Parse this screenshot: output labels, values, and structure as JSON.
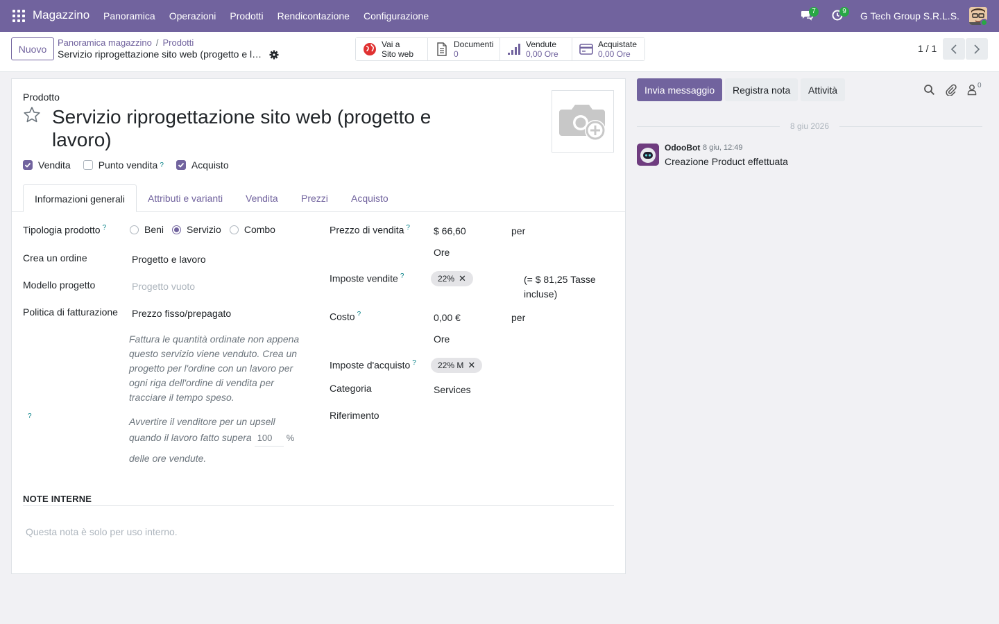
{
  "navbar": {
    "app_name": "Magazzino",
    "menu": [
      "Panoramica",
      "Operazioni",
      "Prodotti",
      "Rendicontazione",
      "Configurazione"
    ],
    "messages_badge": "7",
    "activities_badge": "9",
    "company": "G Tech Group S.R.L.S.",
    "brand_color": "#71639e"
  },
  "control": {
    "new_button": "Nuovo",
    "breadcrumb": [
      "Panoramica magazzino",
      "Prodotti"
    ],
    "breadcrumb_sep": "/",
    "record_title": "Servizio riprogettazione sito web (progetto e lavoro)",
    "smart_buttons": [
      {
        "line1": "Vai a",
        "line2": "Sito web",
        "icon": "globe-icon"
      },
      {
        "line1": "Documenti",
        "line2": "0",
        "icon": "document-icon"
      },
      {
        "line1": "Vendute",
        "line2": "0,00 Ore",
        "icon": "chart-bars-icon"
      },
      {
        "line1": "Acquistate",
        "line2": "0,00 Ore",
        "icon": "credit-card-icon"
      }
    ],
    "pager": "1 / 1"
  },
  "form": {
    "section_label": "Prodotto",
    "name": "Servizio riprogettazione sito web (progetto e lavoro)",
    "checkboxes": [
      {
        "label": "Vendita",
        "checked": true,
        "help": ""
      },
      {
        "label": "Punto vendita",
        "checked": false,
        "help": "?"
      },
      {
        "label": "Acquisto",
        "checked": true,
        "help": ""
      }
    ],
    "tabs": [
      "Informazioni generali",
      "Attributi e varianti",
      "Vendita",
      "Prezzi",
      "Acquisto"
    ],
    "active_tab": "Informazioni generali",
    "left": {
      "product_type_label": "Tipologia prodotto",
      "product_type_options": [
        "Beni",
        "Servizio",
        "Combo"
      ],
      "product_type_selected": "Servizio",
      "create_order_label": "Crea un ordine",
      "create_order_value": "Progetto e lavoro",
      "project_template_label": "Modello progetto",
      "project_template_placeholder": "Progetto vuoto",
      "invoicing_policy_label": "Politica di fatturazione",
      "invoicing_policy_value": "Prezzo fisso/prepagato",
      "invoicing_help": [
        "Fattura le quantità ordinate non appena",
        "questo servizio viene venduto. Crea un",
        "progetto per l'ordine con un lavoro per",
        "ogni riga dell'ordine di vendita per",
        "tracciare il tempo speso."
      ],
      "upsell_text_1": "Avvertire il venditore per un upsell",
      "upsell_text_2": "quando il lavoro fatto supera",
      "upsell_value": "100",
      "upsell_unit": "%",
      "upsell_text_3": "delle ore vendute.",
      "help_mark": "?"
    },
    "right": {
      "sale_price_label": "Prezzo di vendita",
      "sale_price_value": "$ 66,60",
      "per": "per",
      "uom": "Ore",
      "sales_tax_label": "Imposte vendite",
      "sales_tax_tag": "22%",
      "tax_included_1": "(= $ 81,25 Tasse",
      "tax_included_2": "incluse)",
      "cost_label": "Costo",
      "cost_value": "0,00 €",
      "purchase_tax_label": "Imposte d'acquisto",
      "purchase_tax_tag": "22% M",
      "category_label": "Categoria",
      "category_value": "Services",
      "reference_label": "Riferimento",
      "reference_value": ""
    },
    "notes_header": "NOTE INTERNE",
    "notes_placeholder": "Questa nota è solo per uso interno."
  },
  "chatter": {
    "send_message": "Invia messaggio",
    "log_note": "Registra nota",
    "activities": "Attività",
    "followers_count": "0",
    "date_separator": "8 giu 2026",
    "messages": [
      {
        "author": "OdooBot",
        "time": "8 giu, 12:49",
        "body": "Creazione Product effettuata"
      }
    ]
  }
}
